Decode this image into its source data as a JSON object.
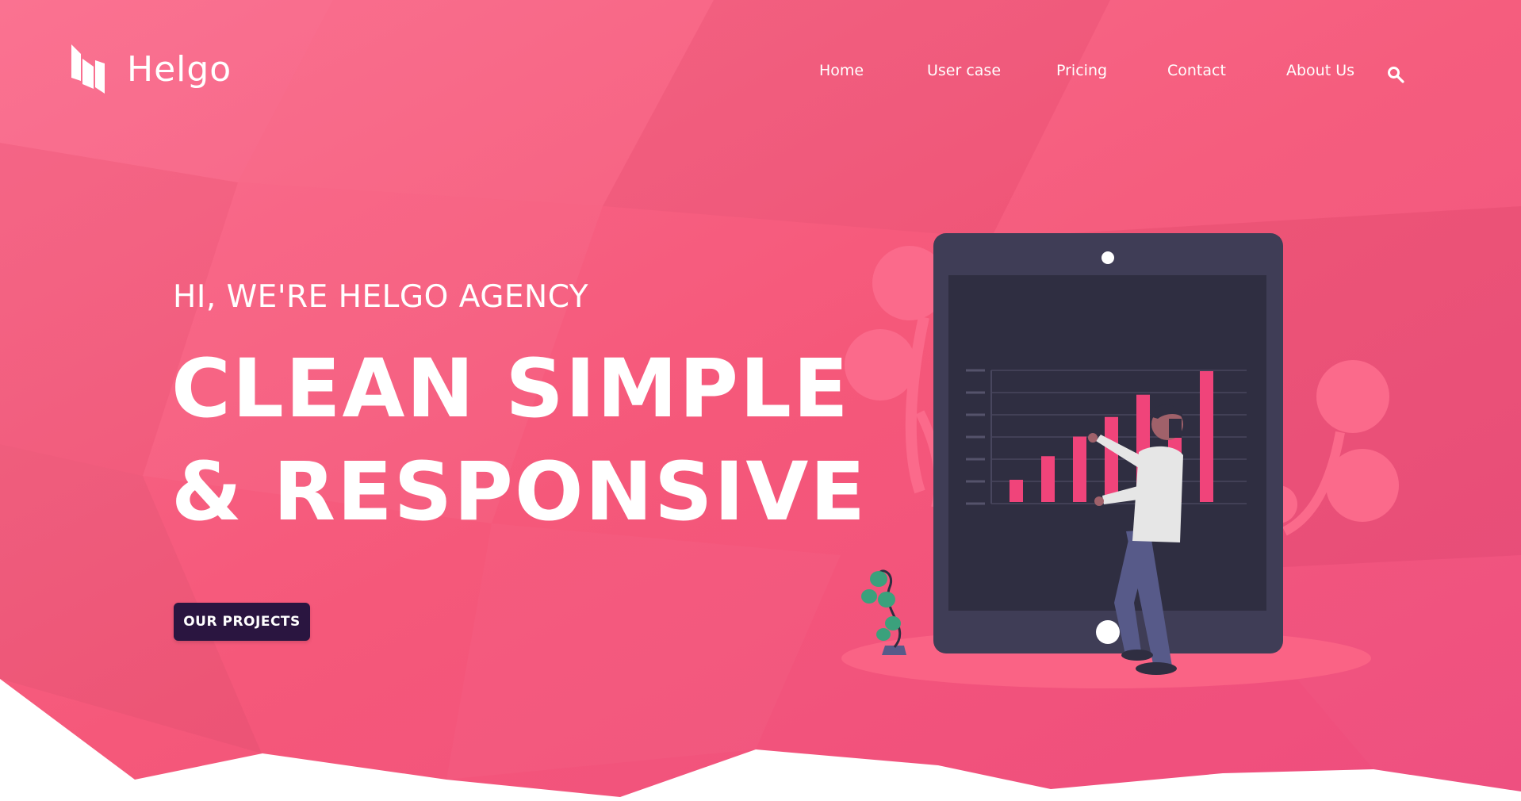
{
  "brand": {
    "name": "Helgo",
    "logo_icon": "helgo-logo-icon"
  },
  "nav": {
    "items": [
      {
        "label": "Home"
      },
      {
        "label": "User case"
      },
      {
        "label": "Pricing"
      },
      {
        "label": "Contact"
      },
      {
        "label": "About Us"
      }
    ],
    "search_icon": "search-icon"
  },
  "hero": {
    "subtitle": "HI, WE'RE HELGO AGENCY",
    "headline_line1": "CLEAN SIMPLE",
    "headline_line2": "& RESPONSIVE",
    "cta_label": "OUR PROJECTS"
  },
  "illustration": {
    "subject": "person-with-tablet-bar-chart",
    "bars": [
      0.17,
      0.35,
      0.5,
      0.65,
      0.82,
      0.65,
      1.0
    ]
  },
  "colors": {
    "background_pink": "#f5587a",
    "accent_dark": "#2a1540",
    "tablet": "#3f3d56",
    "bar": "#f0447a"
  }
}
